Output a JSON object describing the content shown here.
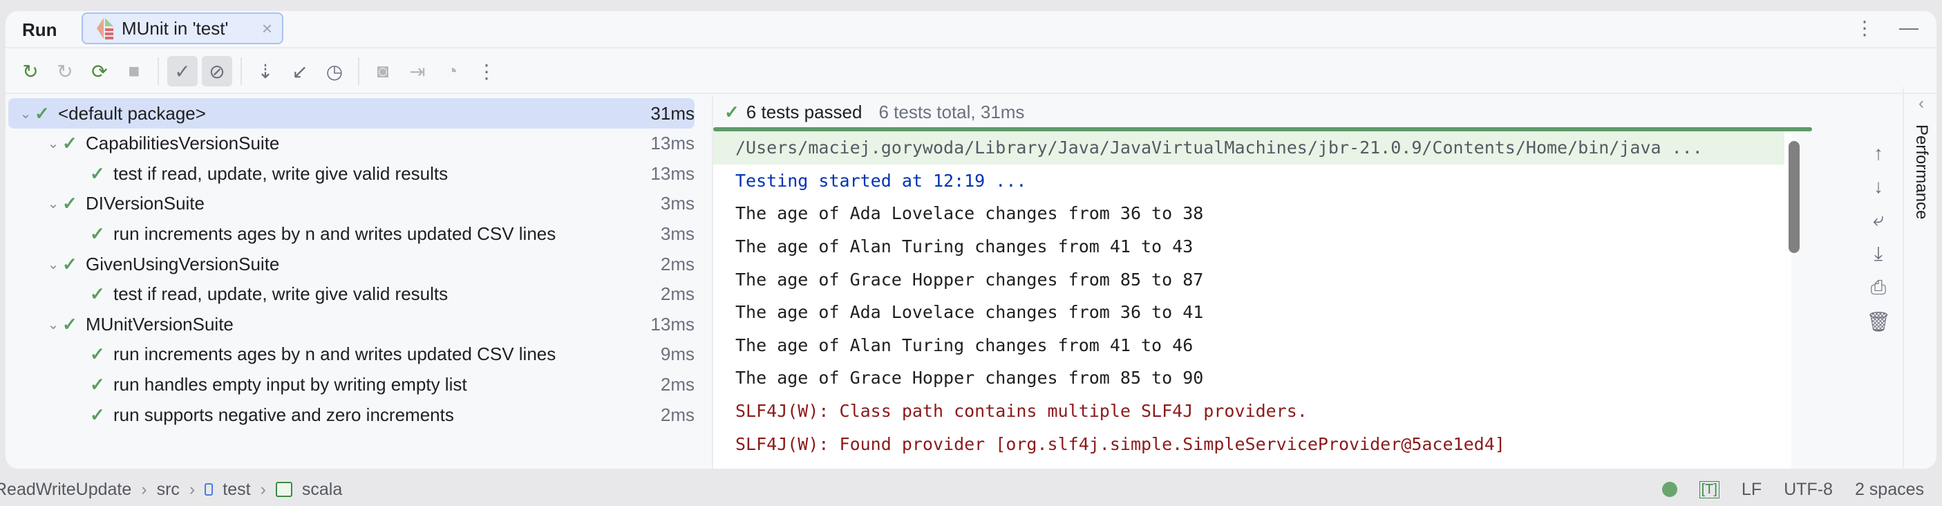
{
  "header": {
    "run_label": "Run",
    "tab_label": "MUnit in 'test'",
    "tab_close": "×"
  },
  "toolbar": {
    "icons": [
      "rerun-icon",
      "rerun-failed-icon",
      "toggle-auto-test-icon",
      "stop-icon",
      "show-passed-icon",
      "show-ignored-icon",
      "sort-icon",
      "collapse-icon",
      "history-icon",
      "screenshot-icon",
      "import-icon",
      "coverage-icon",
      "more-icon"
    ]
  },
  "tree": [
    {
      "label": "<default package>",
      "time": "31ms",
      "level": 0,
      "chev": true
    },
    {
      "label": "CapabilitiesVersionSuite",
      "time": "13ms",
      "level": 1,
      "chev": true
    },
    {
      "label": "test if read, update, write give valid results",
      "time": "13ms",
      "level": 2
    },
    {
      "label": "DIVersionSuite",
      "time": "3ms",
      "level": 1,
      "chev": true
    },
    {
      "label": "run increments ages by n and writes updated CSV lines",
      "time": "3ms",
      "level": 2
    },
    {
      "label": "GivenUsingVersionSuite",
      "time": "2ms",
      "level": 1,
      "chev": true
    },
    {
      "label": "test if read, update, write give valid results",
      "time": "2ms",
      "level": 2
    },
    {
      "label": "MUnitVersionSuite",
      "time": "13ms",
      "level": 1,
      "chev": true
    },
    {
      "label": "run increments ages by n and writes updated CSV lines",
      "time": "9ms",
      "level": 2
    },
    {
      "label": "run handles empty input by writing empty list",
      "time": "2ms",
      "level": 2
    },
    {
      "label": "run supports negative and zero increments",
      "time": "2ms",
      "level": 2
    }
  ],
  "console": {
    "passed": "6 tests passed",
    "total": "6 tests total, 31ms",
    "lines": [
      {
        "text": "/Users/maciej.gorywoda/Library/Java/JavaVirtualMachines/jbr-21.0.9/Contents/Home/bin/java ...",
        "kind": "first"
      },
      {
        "text": "Testing started at 12:19 ...",
        "kind": "blue"
      },
      {
        "text": "The age of Ada Lovelace changes from 36 to 38",
        "kind": "norm"
      },
      {
        "text": "The age of Alan Turing changes from 41 to 43",
        "kind": "norm"
      },
      {
        "text": "The age of Grace Hopper changes from 85 to 87",
        "kind": "norm"
      },
      {
        "text": "The age of Ada Lovelace changes from 36 to 41",
        "kind": "norm"
      },
      {
        "text": "The age of Alan Turing changes from 41 to 46",
        "kind": "norm"
      },
      {
        "text": "The age of Grace Hopper changes from 85 to 90",
        "kind": "norm"
      },
      {
        "text": "SLF4J(W): Class path contains multiple SLF4J providers.",
        "kind": "err"
      },
      {
        "text": "SLF4J(W): Found provider [org.slf4j.simple.SimpleServiceProvider@5ace1ed4]",
        "kind": "err"
      }
    ]
  },
  "side_panel": {
    "label": "Performance"
  },
  "status": {
    "crumbs": [
      "ReadWriteUpdate",
      "src",
      "test",
      "scala"
    ],
    "insert_mode": "[T]",
    "line_sep": "LF",
    "encoding": "UTF-8",
    "indent": "2 spaces"
  },
  "colors": {
    "pass": "#5a9e5f",
    "selection": "#d5e0f8",
    "error": "#8c1a1a",
    "info": "#0033b3"
  }
}
